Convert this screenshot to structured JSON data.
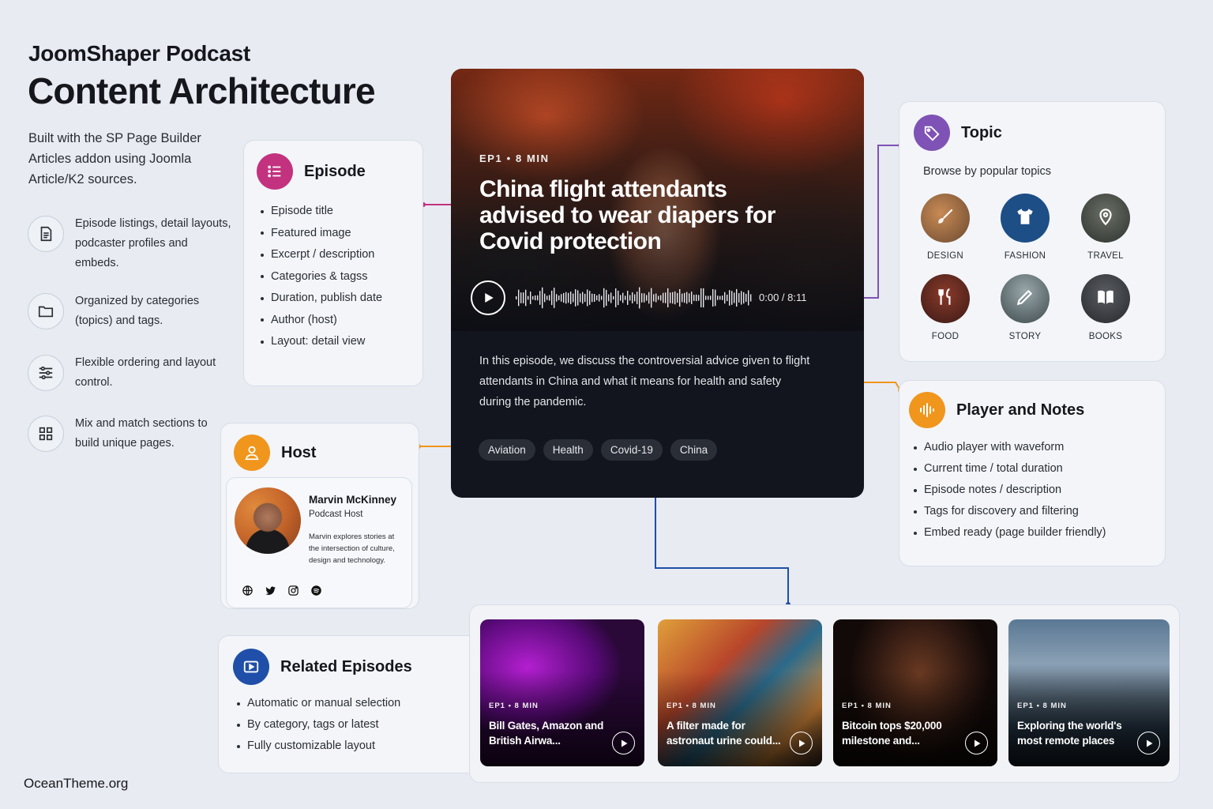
{
  "brand": "JoomShaper Podcast",
  "headline": "Content Architecture",
  "intro": "Built with the SP Page Builder Articles addon using Joomla Article/K2 sources.",
  "features": [
    {
      "icon": "document-icon",
      "text": "Episode listings, detail layouts, podcaster profiles and embeds."
    },
    {
      "icon": "folder-icon",
      "text": "Organized by categories (topics) and tags."
    },
    {
      "icon": "sliders-icon",
      "text": "Flexible ordering and layout control."
    },
    {
      "icon": "grid-icon",
      "text": "Mix and match sections to build unique pages."
    }
  ],
  "episode": {
    "title": "Episode",
    "icon": "list-icon",
    "color": "#c2327f",
    "items": [
      "Episode title",
      "Featured image",
      "Excerpt / description",
      "Categories & tagss",
      "Duration, publish date",
      "Author (host)",
      "Layout: detail view"
    ]
  },
  "hero": {
    "meta": "EP1 • 8 MIN",
    "title": "China flight attendants advised to wear diapers for Covid protection",
    "time": "0:00 / 8:11",
    "description": "In this episode, we discuss the controversial advice given to flight attendants in China and what it means for health and safety during the pandemic.",
    "tags": [
      "Aviation",
      "Health",
      "Covid-19",
      "China"
    ]
  },
  "topic": {
    "title": "Topic",
    "icon": "tag-icon",
    "color": "#7f52b5",
    "subtitle": "Browse by popular topics",
    "items": [
      {
        "label": "DESIGN",
        "icon": "brush-icon",
        "color": "#8a5a3a"
      },
      {
        "label": "FASHION",
        "icon": "shirt-icon",
        "color": "#1d4e86"
      },
      {
        "label": "TRAVEL",
        "icon": "pin-icon",
        "color": "#4a4f48"
      },
      {
        "label": "FOOD",
        "icon": "utensils-icon",
        "color": "#6a2a22"
      },
      {
        "label": "STORY",
        "icon": "pencil-icon",
        "color": "#5a6a6e"
      },
      {
        "label": "BOOKS",
        "icon": "book-icon",
        "color": "#3a3d42"
      }
    ]
  },
  "player": {
    "title": "Player and Notes",
    "icon": "waveform-icon",
    "color": "#f0961c",
    "items": [
      "Audio player with waveform",
      "Current time / total duration",
      "Episode notes / description",
      "Tags for discovery and filtering",
      "Embed ready (page builder friendly)"
    ]
  },
  "host": {
    "title": "Host",
    "icon": "user-icon",
    "color": "#f0961c",
    "name": "Marvin McKinney",
    "role": "Podcast Host",
    "bio": "Marvin explores stories at the intersection of culture, design and technology.",
    "social": [
      "globe-icon",
      "twitter-icon",
      "instagram-icon",
      "spotify-icon"
    ]
  },
  "related": {
    "title": "Related Episodes",
    "icon": "video-icon",
    "color": "#1f4fa8",
    "items": [
      "Automatic or manual selection",
      "By category, tags or latest",
      "Fully customizable layout"
    ],
    "episodes": [
      {
        "meta": "EP1 • 8 MIN",
        "title": "Bill Gates, Amazon and British Airwa..."
      },
      {
        "meta": "EP1 • 8 MIN",
        "title": "A filter made for astronaut urine could..."
      },
      {
        "meta": "EP1 • 8 MIN",
        "title": "Bitcoin tops $20,000 milestone and..."
      },
      {
        "meta": "EP1 • 8 MIN",
        "title": "Exploring the world's most remote places"
      }
    ]
  },
  "footer": "OceanTheme.org"
}
